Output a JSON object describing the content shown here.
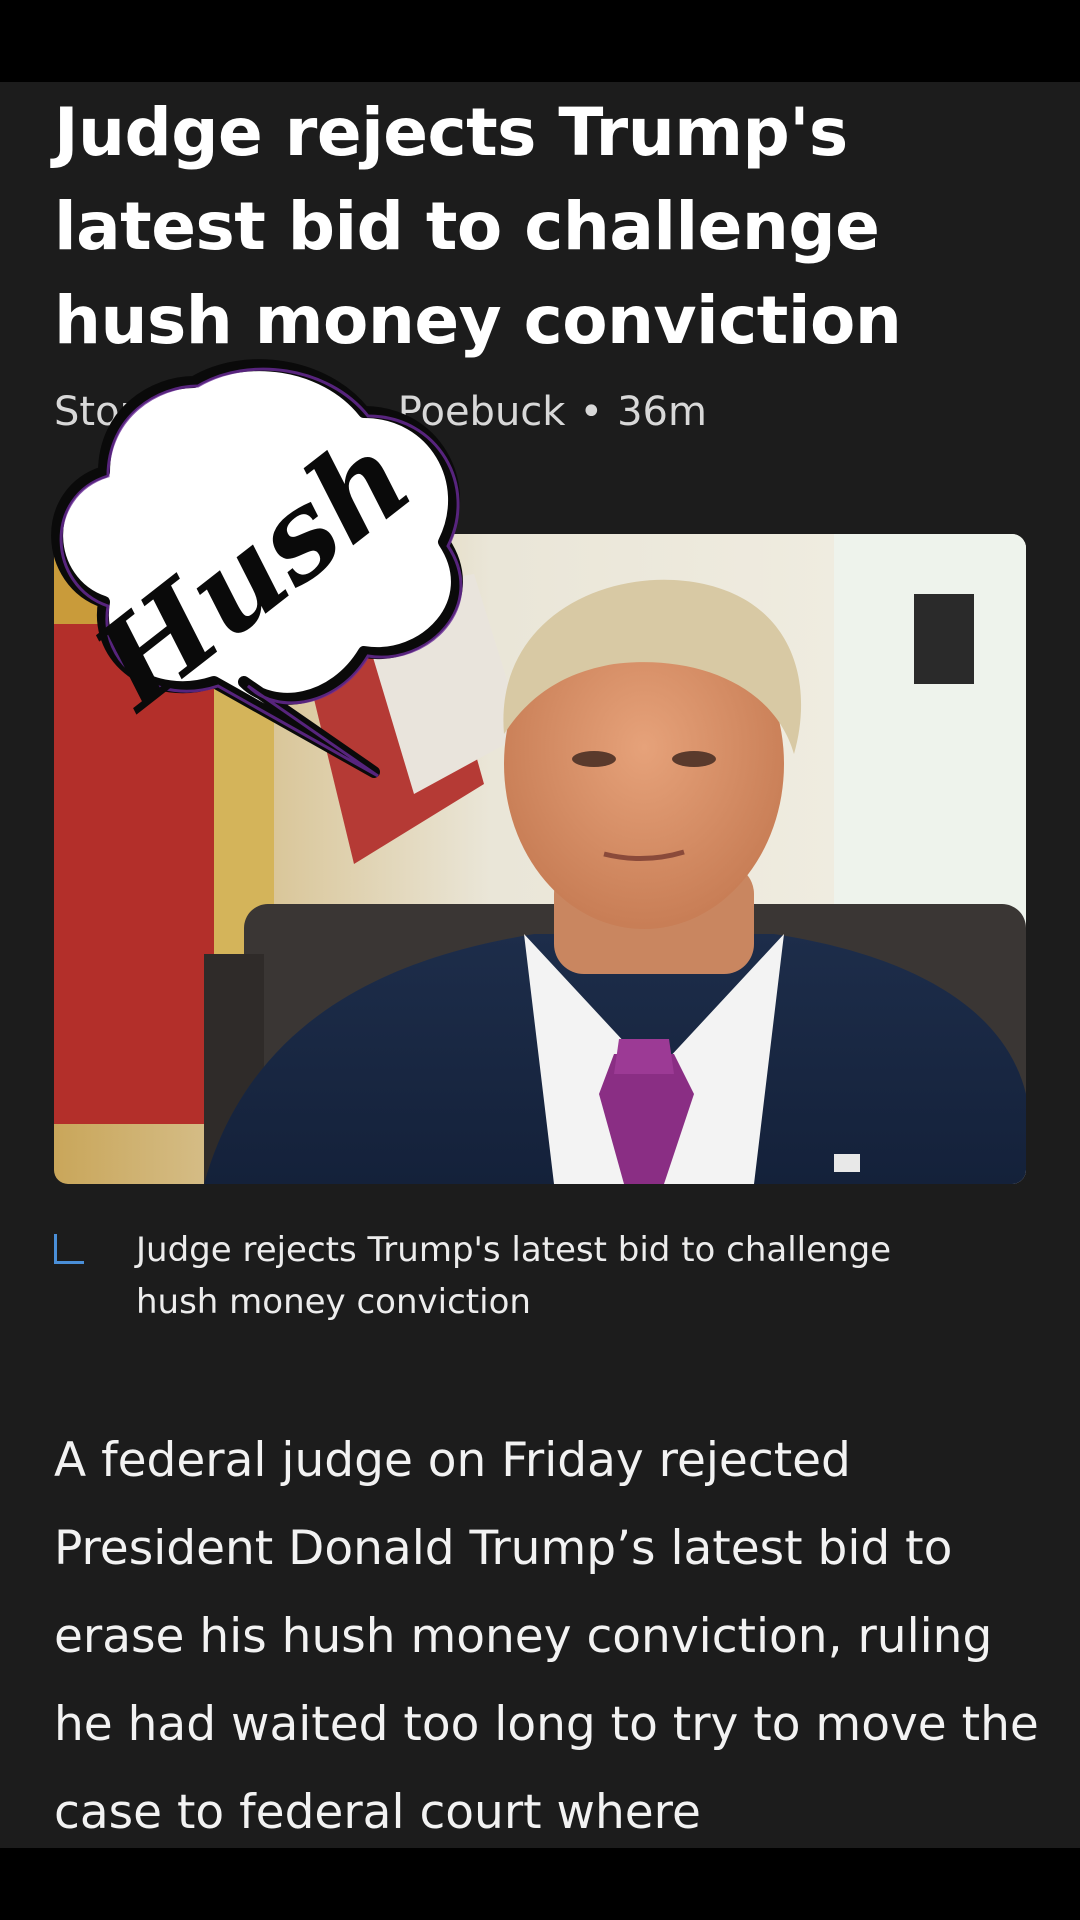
{
  "article": {
    "headline": "Judge rejects Trump's latest bid to challenge hush money conviction",
    "byline_prefix": "Story b",
    "byline_author": "Poebuck",
    "byline_separator": "•",
    "byline_time": "36m",
    "sticker_text": "Hush",
    "hero_image": {
      "description_icon": "photo-icon"
    },
    "caption": "Judge rejects Trump's latest bid to challenge hush money conviction",
    "caption_icon": "corner-bracket-icon",
    "body": "A federal judge on Friday rejected President Donald Trump’s latest bid to erase his hush money conviction, ruling he had waited too long to try to move the case to federal court where"
  },
  "colors": {
    "background": "#1c1c1c",
    "bars": "#000000",
    "caption_accent": "#4a8fd8",
    "text": "#ffffff"
  }
}
